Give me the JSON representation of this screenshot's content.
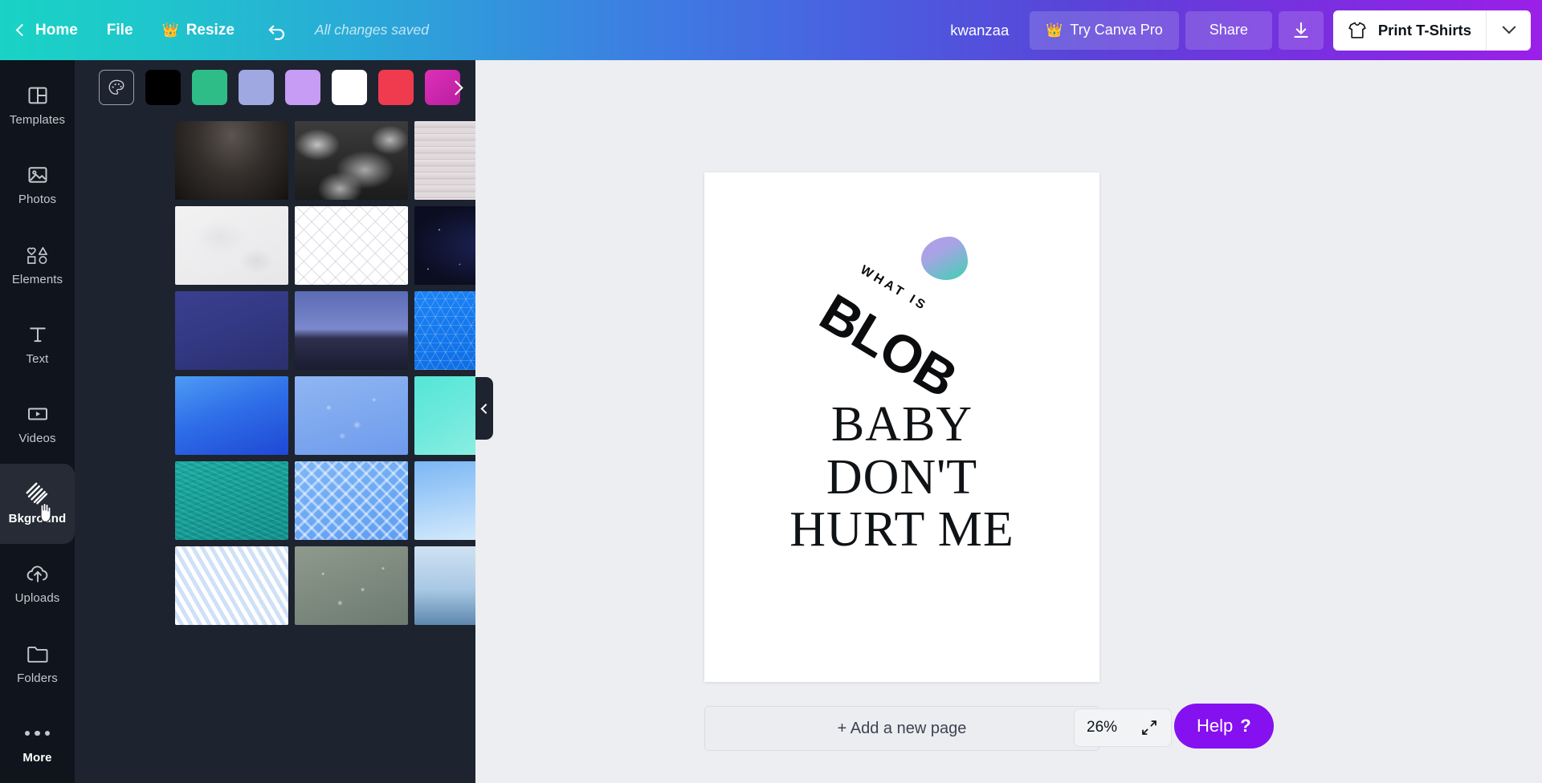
{
  "header": {
    "back_icon": "chevron-left-icon",
    "home_label": "Home",
    "file_label": "File",
    "resize_label": "Resize",
    "resize_icon": "crown-icon",
    "undo_icon": "undo-arrow-icon",
    "save_status": "All changes saved",
    "doc_title": "kwanzaa",
    "try_pro_label": "Try Canva Pro",
    "try_pro_icon": "crown-icon",
    "share_label": "Share",
    "download_icon": "download-icon",
    "print_label": "Print T-Shirts",
    "print_icon": "tshirt-icon",
    "print_caret_icon": "chevron-down-icon",
    "gradient_start": "#19d3c5",
    "gradient_end": "#9b1fe8"
  },
  "sidebar": {
    "items": [
      {
        "label": "Templates",
        "icon": "templates-icon",
        "active": false
      },
      {
        "label": "Photos",
        "icon": "photos-icon",
        "active": false
      },
      {
        "label": "Elements",
        "icon": "elements-icon",
        "active": false
      },
      {
        "label": "Text",
        "icon": "text-icon",
        "active": false
      },
      {
        "label": "Videos",
        "icon": "videos-icon",
        "active": false
      },
      {
        "label": "Bkground",
        "icon": "background-icon",
        "active": true
      },
      {
        "label": "Uploads",
        "icon": "uploads-cloud-icon",
        "active": false
      },
      {
        "label": "Folders",
        "icon": "folder-icon",
        "active": false
      },
      {
        "label": "More",
        "icon": "more-dots-icon",
        "active": false
      }
    ],
    "background": "#10141c",
    "active_background": "#262b36"
  },
  "panel": {
    "color_picker_icon": "palette-icon",
    "next_arrow_icon": "chevron-right-icon",
    "swatches": [
      {
        "name": "color-picker",
        "color": ""
      },
      {
        "name": "black",
        "color": "#000000"
      },
      {
        "name": "green",
        "color": "#2ebd87"
      },
      {
        "name": "periwinkle",
        "color": "#9fa8e0"
      },
      {
        "name": "light-purple",
        "color": "#c79cf5"
      },
      {
        "name": "white",
        "color": "#ffffff"
      },
      {
        "name": "red",
        "color": "#ef3b4d"
      },
      {
        "name": "magenta-gradient",
        "color": "#d81fb0"
      }
    ],
    "backgrounds": [
      {
        "name": "dark-gradient-texture"
      },
      {
        "name": "grey-smoke-clouds"
      },
      {
        "name": "white-wood-planks"
      },
      {
        "name": "white-marble-paper"
      },
      {
        "name": "white-lattice-pattern"
      },
      {
        "name": "dark-navy-starry-sky"
      },
      {
        "name": "deep-blue-violet-gradient"
      },
      {
        "name": "night-sky-mountains"
      },
      {
        "name": "blue-hexagon-pattern"
      },
      {
        "name": "royal-blue-gradient"
      },
      {
        "name": "blue-water-bubbles"
      },
      {
        "name": "teal-mint-gradient"
      },
      {
        "name": "teal-ocean-water"
      },
      {
        "name": "blue-chevron-zigzag"
      },
      {
        "name": "light-blue-sky-gradient"
      },
      {
        "name": "pale-blue-diagonal-stripes"
      },
      {
        "name": "water-droplets-glass"
      },
      {
        "name": "misty-blue-mountains"
      }
    ],
    "collapse_icon": "chevron-left-icon"
  },
  "canvas": {
    "page_tools": [
      {
        "name": "notes-icon"
      },
      {
        "name": "duplicate-page-icon"
      },
      {
        "name": "add-page-icon"
      }
    ],
    "design": {
      "blob_shape": "gradient-blob",
      "arc_text": "WHAT IS",
      "blob_word": "BLOB",
      "headline_lines": [
        "BABY",
        "DON'T",
        "HURT ME"
      ],
      "blob_gradient_start": "#b49ae8",
      "blob_gradient_end": "#3fbfae"
    },
    "add_page_label": "+ Add a new page",
    "zoom_level": "26%",
    "fullscreen_icon": "expand-arrows-icon",
    "help_label": "Help",
    "help_icon": "question-mark-icon",
    "help_color": "#8510f0"
  }
}
